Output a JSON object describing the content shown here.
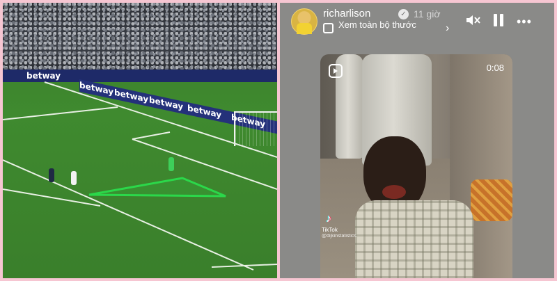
{
  "left_image": {
    "ad_boards": [
      "betway",
      "betway",
      "betway",
      "betway",
      "betway",
      "betway"
    ]
  },
  "story": {
    "username": "richarlison",
    "timestamp": "11 giờ",
    "subline": "Xem toàn bộ thước",
    "video": {
      "duration": "0:08",
      "tiktok_label": "TikTok",
      "tiktok_handle": "@dijkinstatistics"
    },
    "icons": {
      "verified": "verified-badge",
      "reel": "reels-icon",
      "mute": "speaker-muted-icon",
      "pause": "pause-icon",
      "more": "more-icon",
      "chevron": "chevron-right-icon"
    }
  },
  "colors": {
    "frame": "#f6c6d2",
    "pitch": "#3f8a2f",
    "highlight": "#2bd84a",
    "story_bg": "#8a8a88"
  }
}
